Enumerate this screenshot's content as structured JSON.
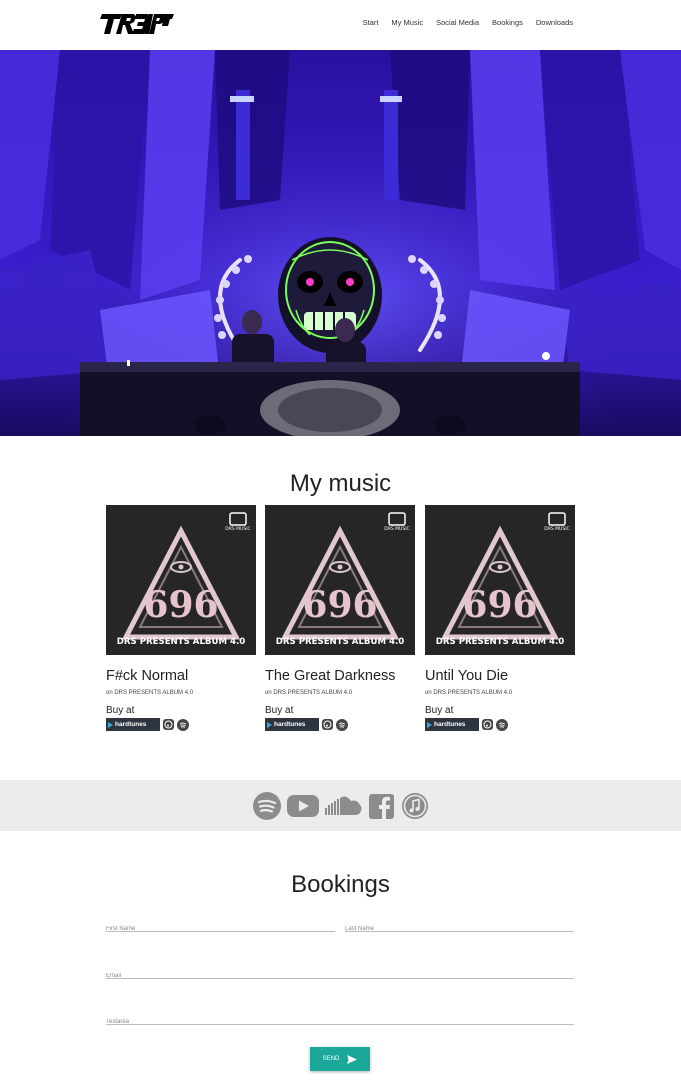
{
  "nav": {
    "logo_text": "TRBIBP",
    "links": [
      "Start",
      "My Music",
      "Social Media",
      "Bookings",
      "Downloads"
    ]
  },
  "music": {
    "title": "My music",
    "albums": [
      {
        "cover_text": "DRS PRESENTS ALBUM 4.0",
        "cover_badge": "DRS MUSIC",
        "cover_number": "696",
        "title": "F#ck Normal",
        "on": "on DRS PRESENTS ALBUM 4.0",
        "buy": "Buy at",
        "store": "hardtunes"
      },
      {
        "cover_text": "DRS PRESENTS ALBUM 4.0",
        "cover_badge": "DRS MUSIC",
        "cover_number": "696",
        "title": "The Great Darkness",
        "on": "on DRS PRESENTS ALBUM 4.0",
        "buy": "Buy at",
        "store": "hardtunes"
      },
      {
        "cover_text": "DRS PRESENTS ALBUM 4.0",
        "cover_badge": "DRS MUSIC",
        "cover_number": "696",
        "title": "Until You Die",
        "on": "on DRS PRESENTS ALBUM 4.0",
        "buy": "Buy at",
        "store": "hardtunes"
      }
    ]
  },
  "social": {
    "icons": [
      "spotify-icon",
      "youtube-icon",
      "soundcloud-icon",
      "facebook-icon",
      "itunes-icon"
    ],
    "color": "#8c8c8c"
  },
  "bookings": {
    "title": "Bookings",
    "first_name_placeholder": "First Name",
    "last_name_placeholder": "Last Name",
    "email_placeholder": "Email",
    "textarea_placeholder": "Textarea",
    "send_label": "SEND"
  },
  "colors": {
    "accent": "#1ba89a",
    "hero": "#2a14a8"
  }
}
